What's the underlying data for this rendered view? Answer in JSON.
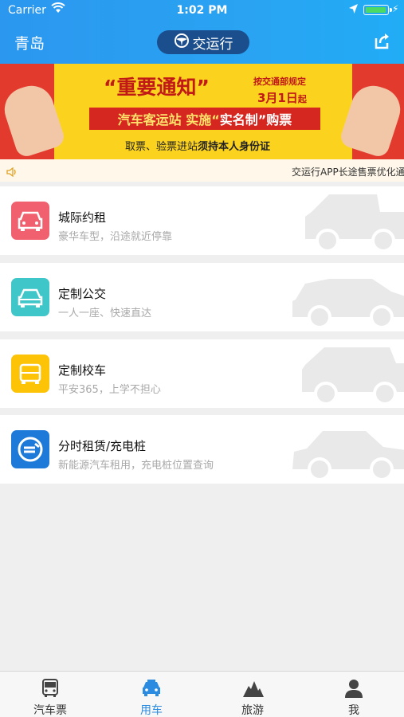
{
  "status_bar": {
    "carrier": "Carrier",
    "time": "1:02 PM"
  },
  "nav": {
    "city": "青岛",
    "brand": "交运行"
  },
  "banner": {
    "open_quote": "“",
    "heading": "重要通知",
    "close_quote": "”",
    "rule": "按交通部规定",
    "date": "3月1日",
    "date_suffix": "起",
    "strip_a": "汽车客运站 实施“",
    "strip_b": "实名制",
    "strip_c": "”购票",
    "id_prefix": "取票、验票进站",
    "id_strong": "须持本人身份证"
  },
  "marquee": {
    "text": "交运行APP长途售票优化通知"
  },
  "services": [
    {
      "title": "城际约租",
      "subtitle": "豪华车型，沿途就近停靠",
      "color": "#f0606e"
    },
    {
      "title": "定制公交",
      "subtitle": "一人一座、快速直达",
      "color": "#3fc6c8"
    },
    {
      "title": "定制校车",
      "subtitle": "平安365，上学不担心",
      "color": "#fcc307"
    },
    {
      "title": "分时租赁/充电桩",
      "subtitle": "新能源汽车租用，充电桩位置查询",
      "color": "#1e7ad8"
    }
  ],
  "tabs": [
    {
      "label": "汽车票",
      "icon": "bus-icon"
    },
    {
      "label": "用车",
      "icon": "car-icon"
    },
    {
      "label": "旅游",
      "icon": "mountain-icon"
    },
    {
      "label": "我",
      "icon": "person-icon"
    }
  ],
  "colors": {
    "primary": "#2a9af0",
    "active_tab": "#2a8be0",
    "banner_red": "#e33a2e",
    "banner_yellow": "#fbd31f"
  }
}
